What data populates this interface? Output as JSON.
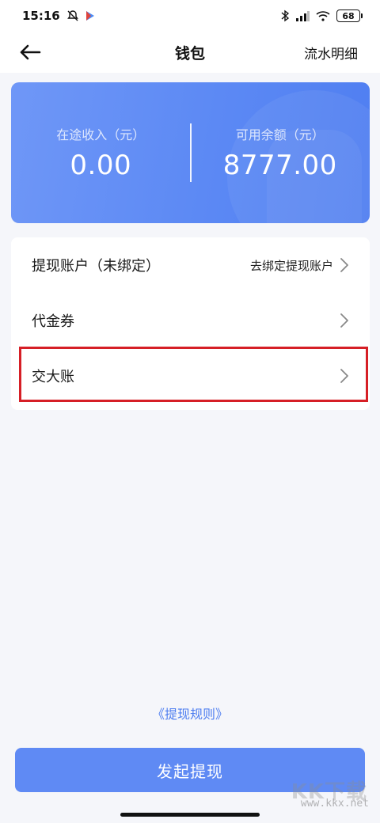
{
  "status_bar": {
    "time": "15:16",
    "battery": "68",
    "icons": [
      "mute-bell-icon",
      "play-store-icon",
      "bluetooth-icon",
      "signal-icon",
      "wifi-icon",
      "battery-icon"
    ]
  },
  "header": {
    "back_icon": "back-arrow-icon",
    "title": "钱包",
    "right_link": "流水明细"
  },
  "balance": {
    "pending_label": "在途收入（元）",
    "pending_value": "0.00",
    "available_label": "可用余额（元）",
    "available_value": "8777.00"
  },
  "menu": {
    "items": [
      {
        "label": "提现账户（未绑定）",
        "right_text": "去绑定提现账户",
        "icon": "chevron-right-icon"
      },
      {
        "label": "代金券",
        "right_text": "",
        "icon": "chevron-right-icon"
      },
      {
        "label": "交大账",
        "right_text": "",
        "icon": "chevron-right-icon"
      }
    ],
    "highlight_color": "#d61f26"
  },
  "rules_link": "《提现规则》",
  "withdraw_button": "发起提现",
  "colors": {
    "accent": "#5f8af4",
    "card": "#5c89f4",
    "link": "#4d7df0"
  },
  "watermark": {
    "logo": "KK下载",
    "url": "www.kkx.net"
  }
}
